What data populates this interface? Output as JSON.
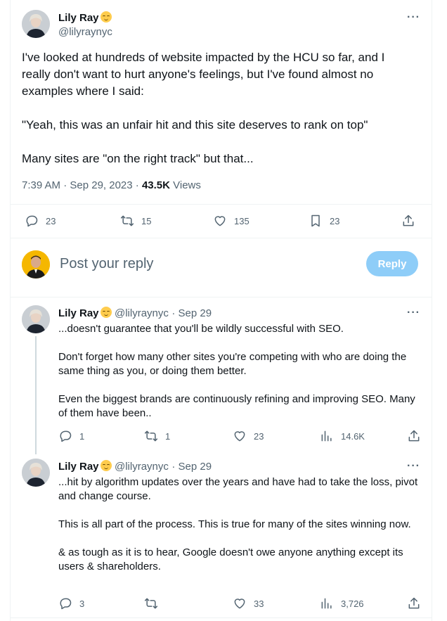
{
  "main_tweet": {
    "author_name": "Lily Ray",
    "author_handle": "@lilyraynyc",
    "text": "I've looked at hundreds of website impacted by the HCU so far, and I really don't want to hurt anyone's feelings, but I've found almost no examples where I said:\n\n\"Yeah, this was an unfair hit and this site deserves to rank on top\"\n\nMany sites are \"on the right track\" but that...",
    "time": "7:39 AM · Sep 29, 2023 · ",
    "views_count": "43.5K",
    "views_label": " Views",
    "stats": {
      "replies": "23",
      "retweets": "15",
      "likes": "135",
      "bookmarks": "23"
    }
  },
  "composer": {
    "placeholder": "Post your reply",
    "reply_button": "Reply"
  },
  "replies": [
    {
      "author_name": "Lily Ray",
      "author_handle": "@lilyraynyc",
      "date": "· Sep 29",
      "text": "...doesn't guarantee that you'll be wildly successful with SEO.\n\nDon't forget how many other sites you're competing with who are doing the same thing as you, or doing them better.\n\nEven the biggest brands are continuously refining and improving SEO. Many of them have been..",
      "stats": {
        "replies": "1",
        "retweets": "1",
        "likes": "23",
        "views": "14.6K"
      }
    },
    {
      "author_name": "Lily Ray",
      "author_handle": "@lilyraynyc",
      "date": "· Sep 29",
      "text": "...hit by algorithm updates over the years and have had to take the loss, pivot and change course.\n\nThis is all part of the process. This is true for many of the sites winning now.\n\n& as tough as it is to hear, Google doesn't owe anyone anything except its users & shareholders.",
      "stats": {
        "replies": "3",
        "retweets": "",
        "likes": "33",
        "views": "3,726"
      }
    }
  ],
  "icons": {
    "reply": "reply-icon",
    "retweet": "retweet-icon",
    "like": "heart-icon",
    "bookmark": "bookmark-icon",
    "share": "share-icon",
    "views": "views-icon",
    "more": "more-icon"
  },
  "colors": {
    "accent_disabled": "#8ecdf8",
    "text_secondary": "#536471",
    "border": "#eff3f4"
  }
}
